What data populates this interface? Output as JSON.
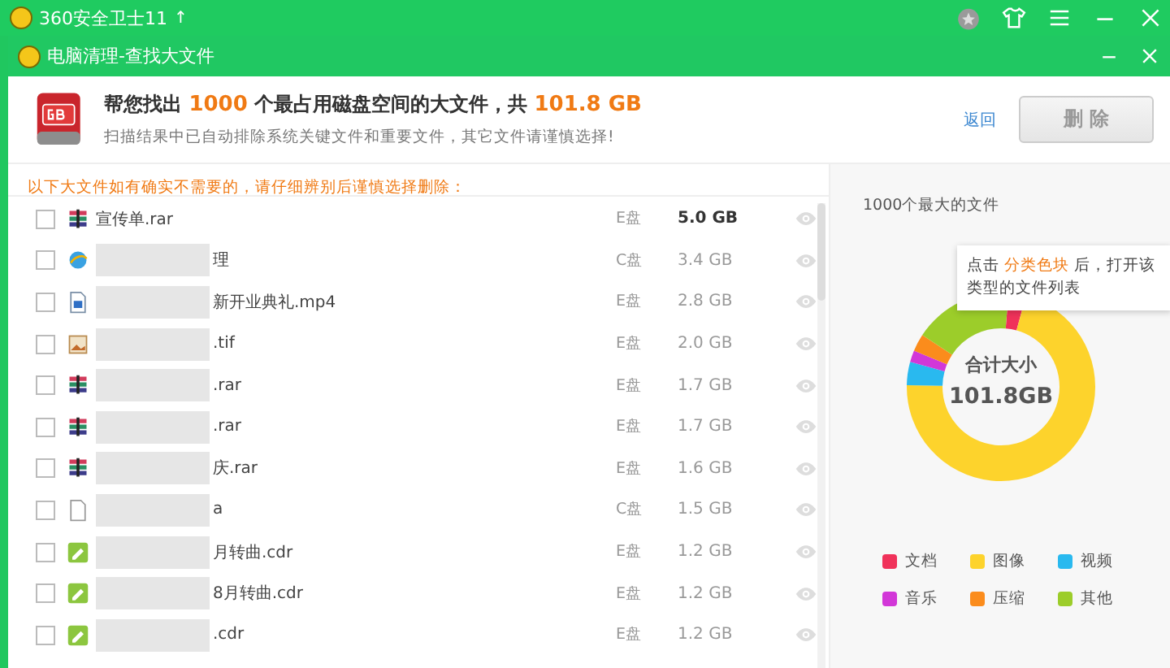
{
  "app_bar": {
    "title": "360安全卫士11",
    "up_arrow": "↑"
  },
  "window": {
    "title": "电脑清理-查找大文件"
  },
  "header": {
    "headline": "帮您找出 **1000** 个最占用磁盘空间的大文件，共 **101.8 GB**",
    "note": "扫描结果中已自动排除系统关键文件和重要文件，其它文件请谨慎选择!",
    "back_link": "返回",
    "delete_button": {
      "label": "删 除",
      "disabled": true
    }
  },
  "warning": "以下大文件如有确实不需要的，请仔细辨别后谨慎选择删除：",
  "files": [
    {
      "kind": "archive",
      "name": "宣传单.rar",
      "blurred": false,
      "drive": "E盘",
      "size": "5.0 GB",
      "checked": false,
      "emphasized": true
    },
    {
      "kind": "web",
      "name": "理",
      "blurred": true,
      "drive": "C盘",
      "size": "3.4 GB",
      "checked": false,
      "emphasized": false
    },
    {
      "kind": "video",
      "name": "新开业典礼.mp4",
      "blurred": true,
      "drive": "E盘",
      "size": "2.8 GB",
      "checked": false,
      "emphasized": false
    },
    {
      "kind": "image",
      "name": ".tif",
      "blurred": true,
      "drive": "E盘",
      "size": "2.0 GB",
      "checked": false,
      "emphasized": false
    },
    {
      "kind": "archive",
      "name": ".rar",
      "blurred": true,
      "drive": "E盘",
      "size": "1.7 GB",
      "checked": false,
      "emphasized": false
    },
    {
      "kind": "archive",
      "name": ".rar",
      "blurred": true,
      "drive": "E盘",
      "size": "1.7 GB",
      "checked": false,
      "emphasized": false
    },
    {
      "kind": "archive",
      "name": "庆.rar",
      "blurred": true,
      "drive": "E盘",
      "size": "1.6 GB",
      "checked": false,
      "emphasized": false
    },
    {
      "kind": "file",
      "name": "a",
      "blurred": true,
      "drive": "C盘",
      "size": "1.5 GB",
      "checked": false,
      "emphasized": false
    },
    {
      "kind": "drawing",
      "name": "月转曲.cdr",
      "blurred": true,
      "drive": "E盘",
      "size": "1.2 GB",
      "checked": false,
      "emphasized": false
    },
    {
      "kind": "drawing",
      "name": "8月转曲.cdr",
      "blurred": true,
      "drive": "E盘",
      "size": "1.2 GB",
      "checked": false,
      "emphasized": false
    },
    {
      "kind": "drawing",
      "name": ".cdr",
      "blurred": true,
      "drive": "E盘",
      "size": "1.2 GB",
      "checked": false,
      "emphasized": false
    }
  ],
  "summary": {
    "title": "1000个最大的文件",
    "tooltip": "点击 **分类色块** 后，打开该类型的文件列表",
    "center_label": "合计大小",
    "center_value": "101.8GB",
    "legend": [
      {
        "label": "文档",
        "color": "#f0325a"
      },
      {
        "label": "图像",
        "color": "#fdd32c"
      },
      {
        "label": "视频",
        "color": "#29b9ef"
      },
      {
        "label": "音乐",
        "color": "#d237d8"
      },
      {
        "label": "压缩",
        "color": "#fb8c1c"
      },
      {
        "label": "其他",
        "color": "#9ccd2a"
      }
    ]
  }
}
